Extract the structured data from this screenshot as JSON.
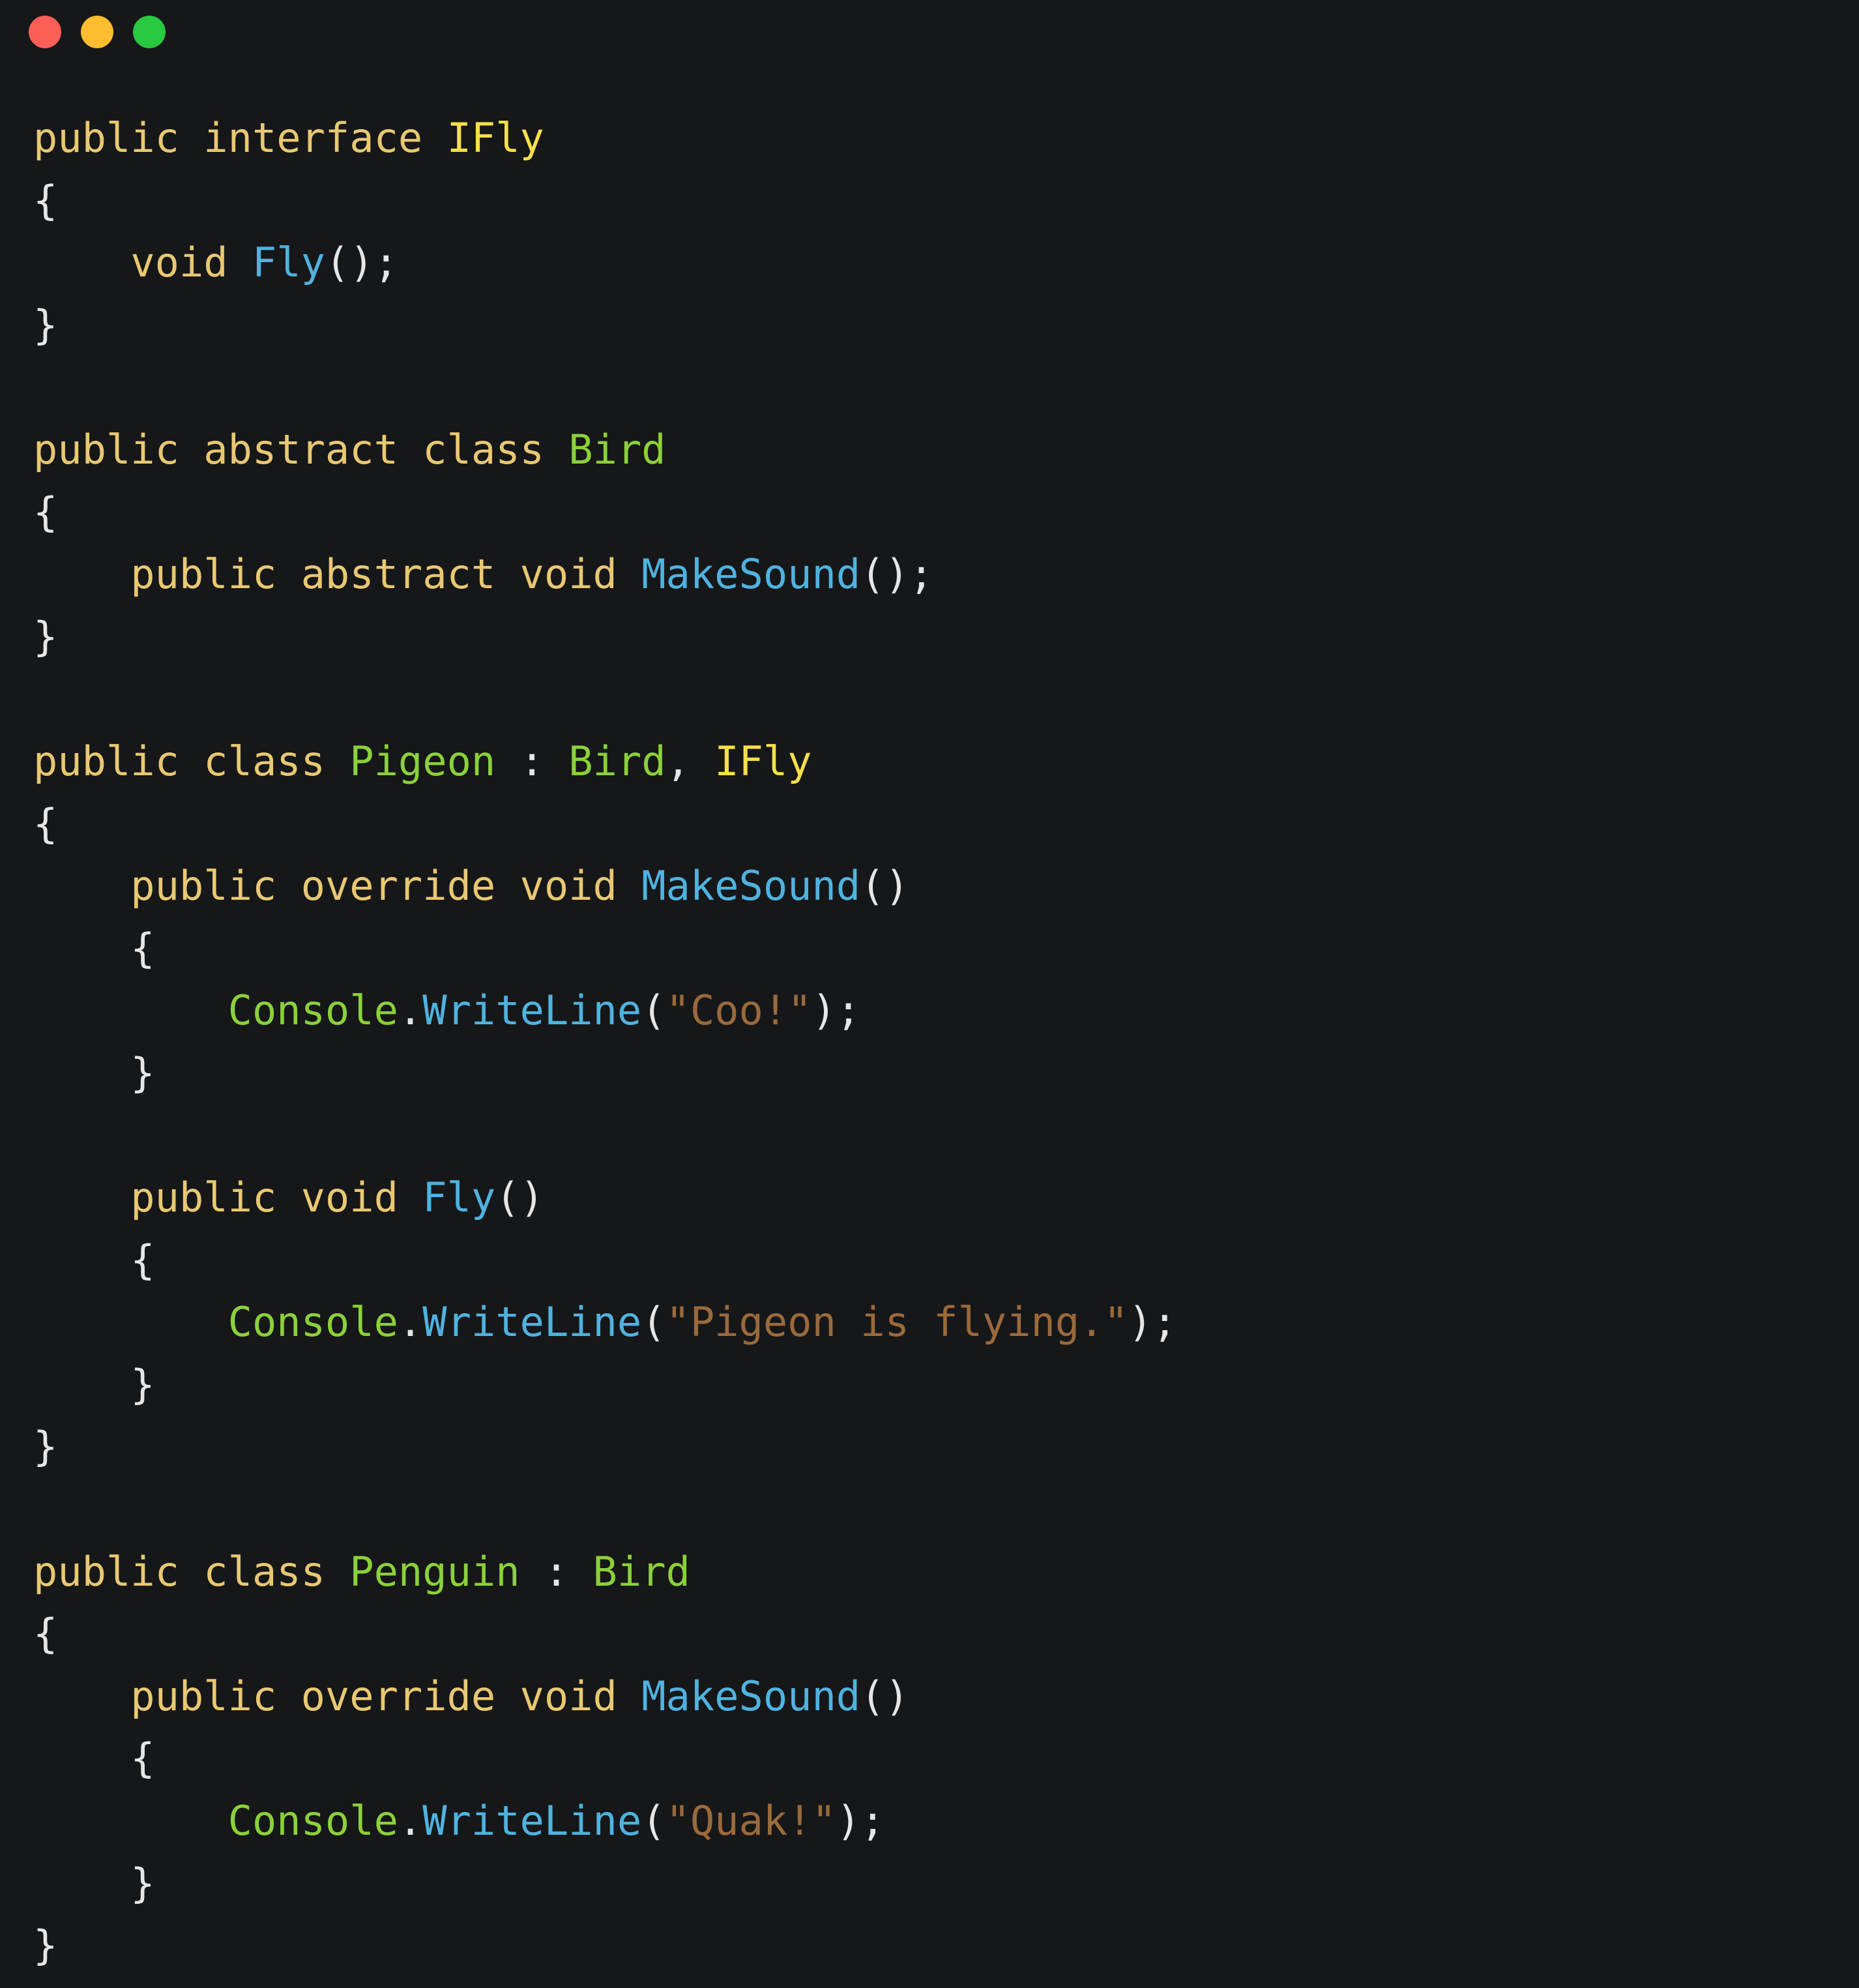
{
  "window": {
    "buttons": [
      {
        "name": "close",
        "color": "#ff5f57"
      },
      {
        "name": "minimize",
        "color": "#febc2e"
      },
      {
        "name": "maximize",
        "color": "#28c840"
      }
    ]
  },
  "colors": {
    "background": "#161719",
    "keyword": "#e8c872",
    "interface": "#f5e04a",
    "class": "#8bd13a",
    "method": "#4fb3e0",
    "string": "#9a6a3c",
    "punct": "#e6e6e6"
  },
  "code": {
    "language": "C#",
    "lines": [
      [
        {
          "t": "public interface ",
          "k": "keyword"
        },
        {
          "t": "IFly",
          "k": "interface"
        }
      ],
      [
        {
          "t": "{",
          "k": "punct"
        }
      ],
      [
        {
          "t": "    void ",
          "k": "keyword"
        },
        {
          "t": "Fly",
          "k": "method"
        },
        {
          "t": "();",
          "k": "punct"
        }
      ],
      [
        {
          "t": "}",
          "k": "punct"
        }
      ],
      [],
      [
        {
          "t": "public abstract class ",
          "k": "keyword"
        },
        {
          "t": "Bird",
          "k": "class"
        }
      ],
      [
        {
          "t": "{",
          "k": "punct"
        }
      ],
      [
        {
          "t": "    public abstract void ",
          "k": "keyword"
        },
        {
          "t": "MakeSound",
          "k": "method"
        },
        {
          "t": "();",
          "k": "punct"
        }
      ],
      [
        {
          "t": "}",
          "k": "punct"
        }
      ],
      [],
      [
        {
          "t": "public class ",
          "k": "keyword"
        },
        {
          "t": "Pigeon",
          "k": "class"
        },
        {
          "t": " : ",
          "k": "punct"
        },
        {
          "t": "Bird",
          "k": "class"
        },
        {
          "t": ", ",
          "k": "punct"
        },
        {
          "t": "IFly",
          "k": "interface"
        }
      ],
      [
        {
          "t": "{",
          "k": "punct"
        }
      ],
      [
        {
          "t": "    public override void ",
          "k": "keyword"
        },
        {
          "t": "MakeSound",
          "k": "method"
        },
        {
          "t": "()",
          "k": "punct"
        }
      ],
      [
        {
          "t": "    {",
          "k": "punct"
        }
      ],
      [
        {
          "t": "        ",
          "k": "punct"
        },
        {
          "t": "Console",
          "k": "class"
        },
        {
          "t": ".",
          "k": "punct"
        },
        {
          "t": "WriteLine",
          "k": "method"
        },
        {
          "t": "(",
          "k": "punct"
        },
        {
          "t": "\"Coo!\"",
          "k": "string"
        },
        {
          "t": ");",
          "k": "punct"
        }
      ],
      [
        {
          "t": "    }",
          "k": "punct"
        }
      ],
      [],
      [
        {
          "t": "    public void ",
          "k": "keyword"
        },
        {
          "t": "Fly",
          "k": "method"
        },
        {
          "t": "()",
          "k": "punct"
        }
      ],
      [
        {
          "t": "    {",
          "k": "punct"
        }
      ],
      [
        {
          "t": "        ",
          "k": "punct"
        },
        {
          "t": "Console",
          "k": "class"
        },
        {
          "t": ".",
          "k": "punct"
        },
        {
          "t": "WriteLine",
          "k": "method"
        },
        {
          "t": "(",
          "k": "punct"
        },
        {
          "t": "\"Pigeon is flying.\"",
          "k": "string"
        },
        {
          "t": ");",
          "k": "punct"
        }
      ],
      [
        {
          "t": "    }",
          "k": "punct"
        }
      ],
      [
        {
          "t": "}",
          "k": "punct"
        }
      ],
      [],
      [
        {
          "t": "public class ",
          "k": "keyword"
        },
        {
          "t": "Penguin",
          "k": "class"
        },
        {
          "t": " : ",
          "k": "punct"
        },
        {
          "t": "Bird",
          "k": "class"
        }
      ],
      [
        {
          "t": "{",
          "k": "punct"
        }
      ],
      [
        {
          "t": "    public override void ",
          "k": "keyword"
        },
        {
          "t": "MakeSound",
          "k": "method"
        },
        {
          "t": "()",
          "k": "punct"
        }
      ],
      [
        {
          "t": "    {",
          "k": "punct"
        }
      ],
      [
        {
          "t": "        ",
          "k": "punct"
        },
        {
          "t": "Console",
          "k": "class"
        },
        {
          "t": ".",
          "k": "punct"
        },
        {
          "t": "WriteLine",
          "k": "method"
        },
        {
          "t": "(",
          "k": "punct"
        },
        {
          "t": "\"Quak!\"",
          "k": "string"
        },
        {
          "t": ");",
          "k": "punct"
        }
      ],
      [
        {
          "t": "    }",
          "k": "punct"
        }
      ],
      [
        {
          "t": "}",
          "k": "punct"
        }
      ]
    ]
  }
}
